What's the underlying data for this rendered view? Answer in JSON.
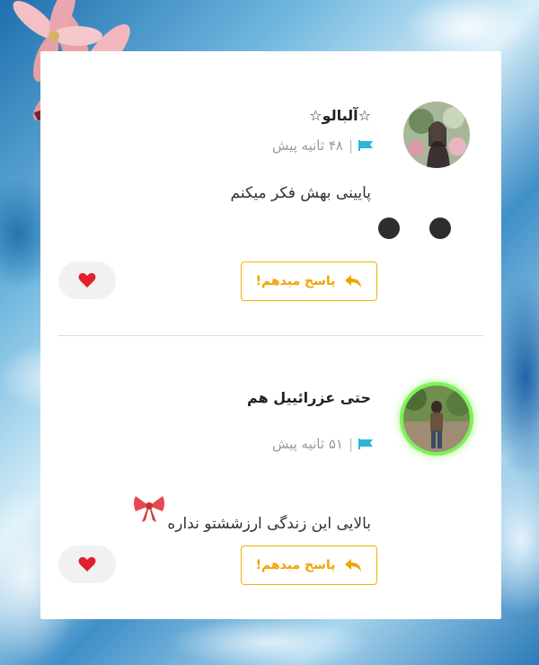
{
  "comments": [
    {
      "name": "☆آلبالو☆",
      "time": "۴۸ ثانیه پیش",
      "text": "پایینی بهش فکر میکنم",
      "reply_label": "پاسخ میدهم!",
      "avatar": "avatar-photo-icon"
    },
    {
      "name": "حتی عزرائییل هم",
      "time": "۵۱ ثانیه پیش",
      "text": "بالایی این زندگی ارزششتو نداره",
      "reply_label": "پاسخ میدهم!",
      "avatar": "avatar-photo-icon"
    }
  ],
  "colors": {
    "accent": "#f0a500",
    "flag": "#2bb5d8",
    "heart": "#e0202a"
  }
}
